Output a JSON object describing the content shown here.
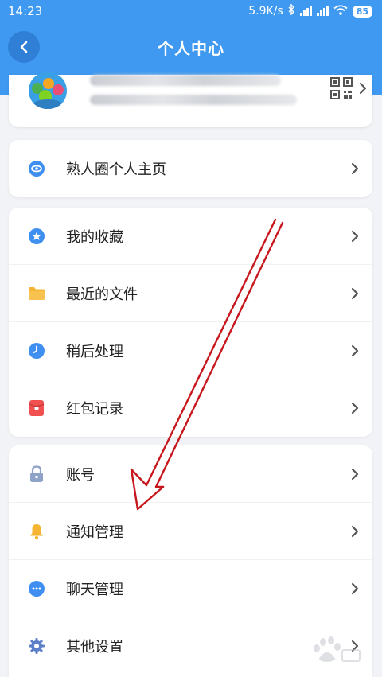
{
  "status_bar": {
    "time": "14:23",
    "network_speed": "5.9K/s",
    "battery": "85"
  },
  "header": {
    "title": "个人中心"
  },
  "profile": {
    "name_blurred": "",
    "account_id_blurred": ""
  },
  "sections": [
    {
      "items": [
        {
          "label": "熟人圈个人主页",
          "icon": "circle-ring-icon",
          "color": "#3f8ff0"
        }
      ]
    },
    {
      "items": [
        {
          "label": "我的收藏",
          "icon": "star-icon",
          "color": "#3f8ff0"
        },
        {
          "label": "最近的文件",
          "icon": "folder-icon",
          "color": "#f5b532"
        },
        {
          "label": "稍后处理",
          "icon": "clock-icon",
          "color": "#3f8ff0"
        },
        {
          "label": "红包记录",
          "icon": "red-envelope-icon",
          "color": "#f05050"
        }
      ]
    },
    {
      "items": [
        {
          "label": "账号",
          "icon": "lock-icon",
          "color": "#8fa2c7"
        },
        {
          "label": "通知管理",
          "icon": "bell-icon",
          "color": "#f5b532"
        },
        {
          "label": "聊天管理",
          "icon": "chat-bubble-icon",
          "color": "#3f8ff0"
        },
        {
          "label": "其他设置",
          "icon": "gear-icon",
          "color": "#5b7fc9"
        }
      ]
    }
  ],
  "colors": {
    "brand": "#3f99f0",
    "background": "#f1f3f6",
    "annotation_arrow": "#c8161d"
  }
}
